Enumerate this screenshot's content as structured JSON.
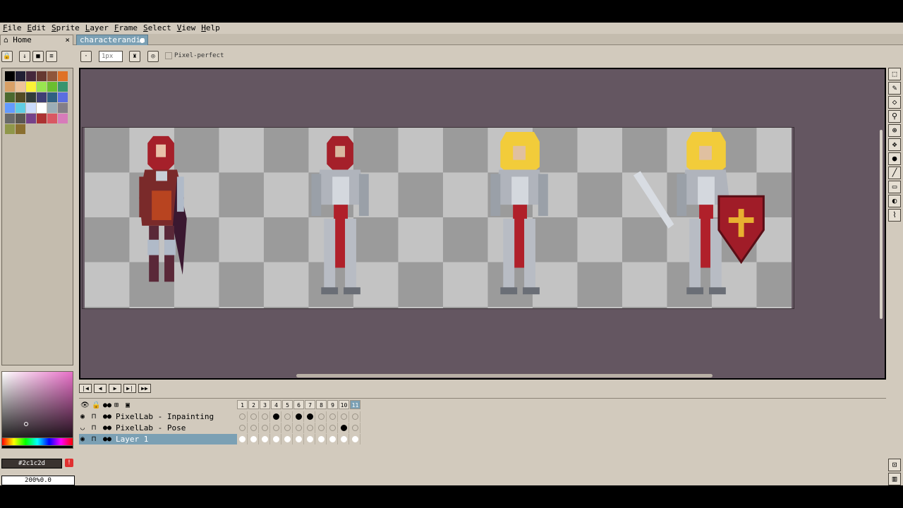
{
  "menu": [
    "File",
    "Edit",
    "Sprite",
    "Layer",
    "Frame",
    "Select",
    "View",
    "Help"
  ],
  "tabs": {
    "home": "Home",
    "home_close": "×",
    "active": "characterandin"
  },
  "context": {
    "brush_size": "1px",
    "pixel_perfect": "Pixel-perfect"
  },
  "colors": {
    "hex": "#2c1c2d",
    "warn": "!",
    "accent": "#7ba0b4",
    "canvas_bg": "#645661"
  },
  "zoom": "200%0.0",
  "palette": [
    "#000000",
    "#222034",
    "#45283c",
    "#663931",
    "#8f563b",
    "#df7126",
    "#d9a066",
    "#eec39a",
    "#fbf236",
    "#99e550",
    "#6abe30",
    "#37946e",
    "#4b692f",
    "#524b24",
    "#323c39",
    "#3f3f74",
    "#306082",
    "#5b6ee1",
    "#639bff",
    "#5fcde4",
    "#cbdbfc",
    "#ffffff",
    "#9badb7",
    "#847e87",
    "#696a6a",
    "#595652",
    "#76428a",
    "#ac3232",
    "#d95763",
    "#d77bba",
    "#8f974a",
    "#8a6f30"
  ],
  "layers": [
    {
      "name": "PixelLab - Inpainting",
      "visible": true,
      "cells": [
        0,
        0,
        0,
        1,
        0,
        1,
        1,
        0,
        0,
        0,
        0
      ]
    },
    {
      "name": "PixelLab - Pose",
      "visible": false,
      "cells": [
        0,
        0,
        0,
        0,
        0,
        0,
        0,
        0,
        0,
        1,
        0
      ]
    },
    {
      "name": "Layer 1",
      "visible": true,
      "cells": [
        2,
        2,
        2,
        2,
        2,
        2,
        2,
        2,
        2,
        2,
        2
      ]
    }
  ],
  "frames": [
    "1",
    "2",
    "3",
    "4",
    "5",
    "6",
    "7",
    "8",
    "9",
    "10",
    "11"
  ]
}
